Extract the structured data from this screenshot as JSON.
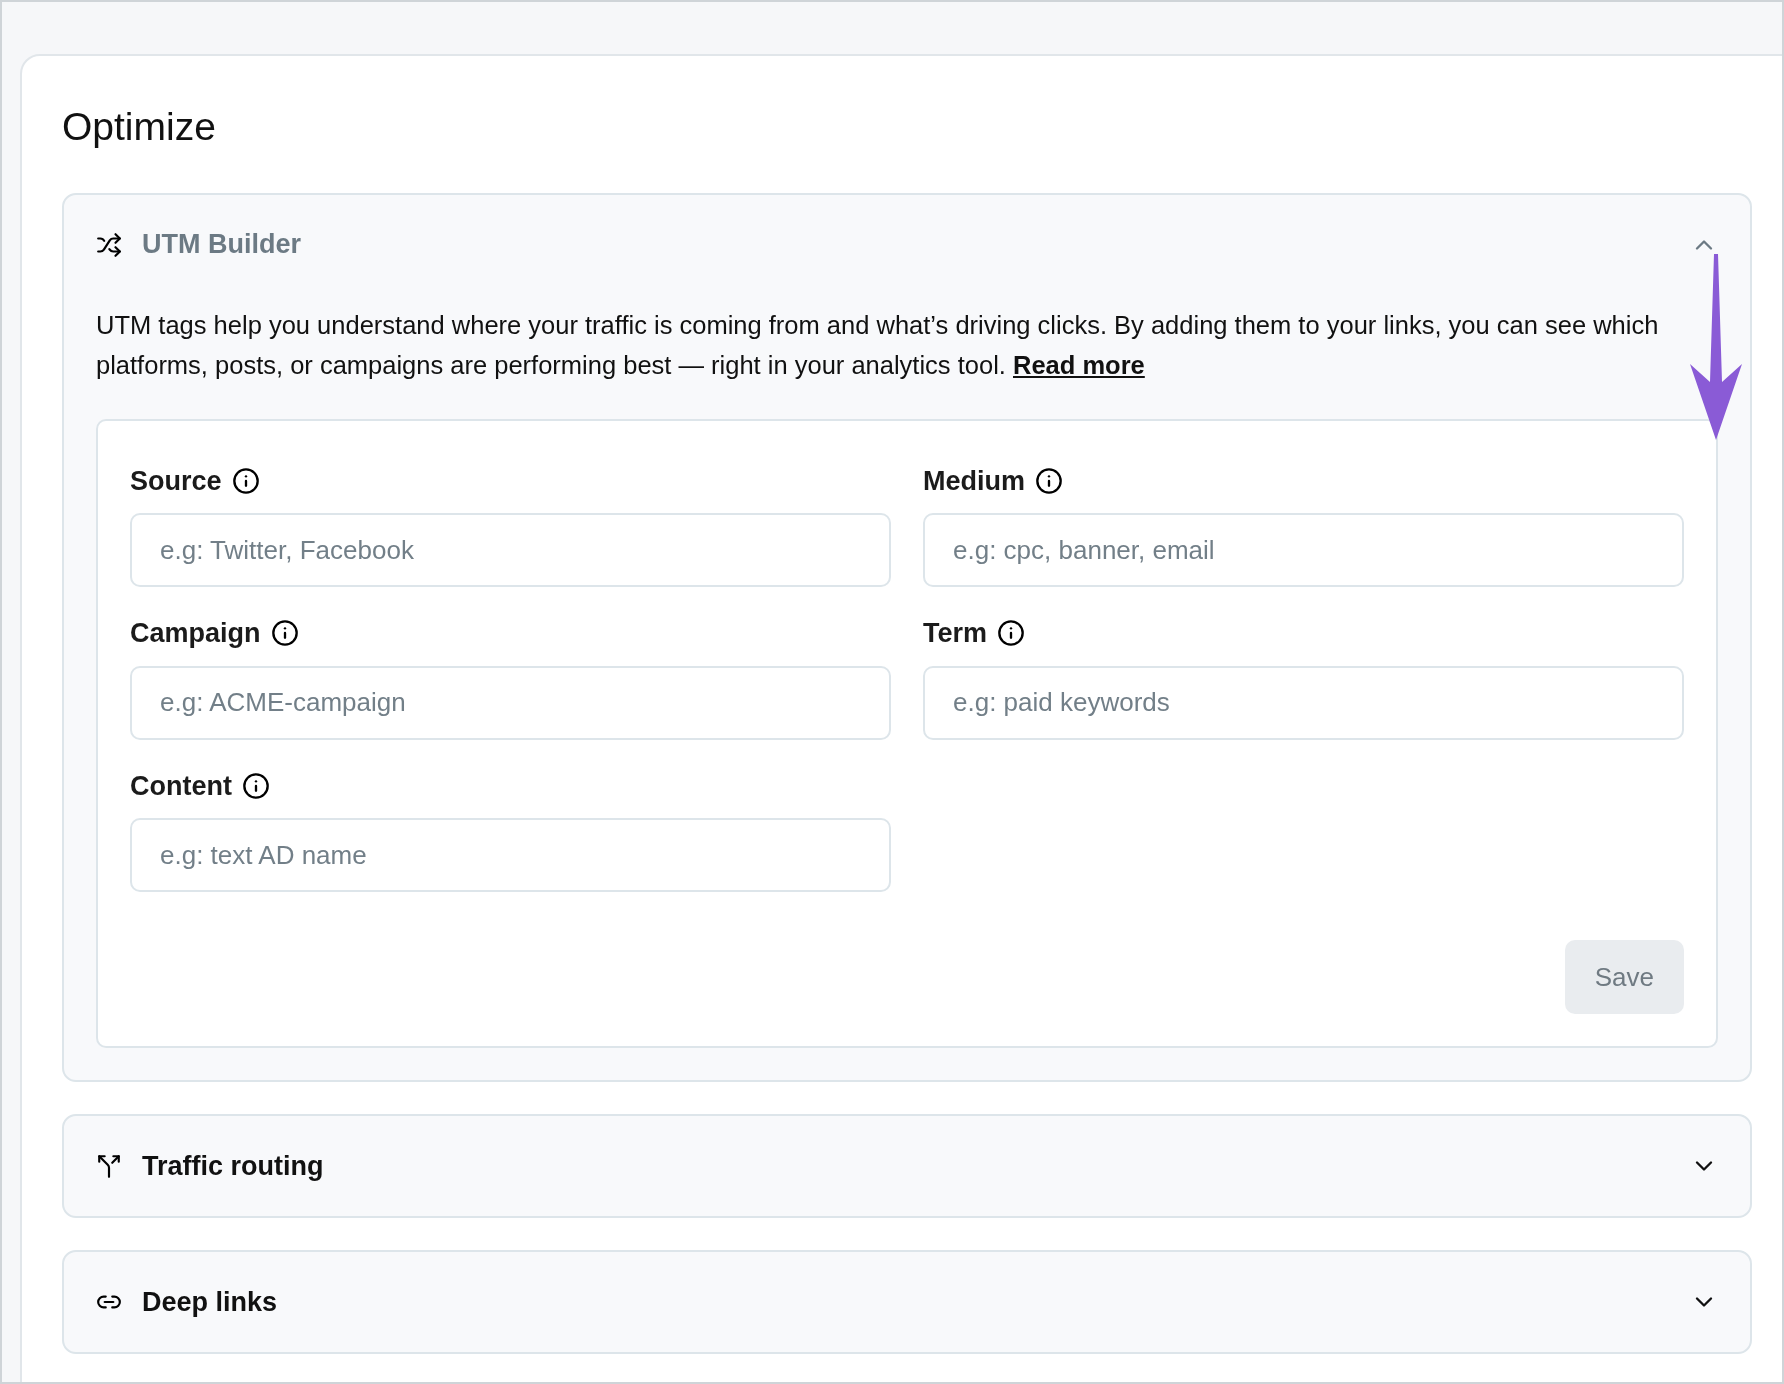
{
  "page": {
    "title": "Optimize"
  },
  "sections": [
    {
      "kind": "utm",
      "title": "UTM Builder",
      "expanded": true,
      "description": "UTM tags help you understand where your traffic is coming from and what’s driving clicks. By adding them to your links, you can see which platforms, posts, or campaigns are performing best — right in your analytics tool.",
      "link": "Read more",
      "fields": [
        {
          "label": "Source",
          "placeholder": "e.g: Twitter, Facebook"
        },
        {
          "label": "Medium",
          "placeholder": "e.g: cpc, banner, email"
        },
        {
          "label": "Campaign",
          "placeholder": "e.g: ACME-campaign"
        },
        {
          "label": "Term",
          "placeholder": "e.g: paid keywords"
        },
        {
          "label": "Content",
          "placeholder": "e.g: text AD name"
        }
      ],
      "save": {
        "label": "Save",
        "disabled": true
      }
    },
    {
      "kind": "routing",
      "title": "Traffic routing",
      "expanded": false
    },
    {
      "kind": "deeplinks",
      "title": "Deep links",
      "expanded": false
    }
  ],
  "annotation": {
    "kind": "arrow-down",
    "color": "#8a5bd6"
  }
}
